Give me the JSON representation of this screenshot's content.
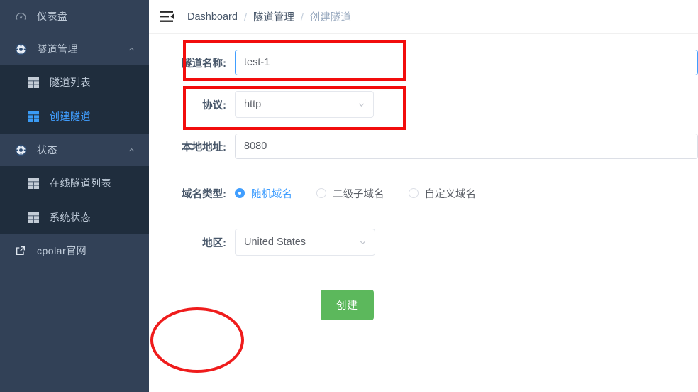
{
  "sidebar": {
    "items": [
      {
        "label": "仪表盘",
        "icon": "dashboard-icon",
        "type": "link"
      },
      {
        "label": "隧道管理",
        "icon": "compass-icon",
        "type": "group",
        "expanded": true,
        "arrow": "chevron-up-icon"
      },
      {
        "label": "状态",
        "icon": "compass-icon",
        "type": "group",
        "expanded": true,
        "arrow": "chevron-up-icon"
      },
      {
        "label": "cpolar官网",
        "icon": "external-link-icon",
        "type": "link"
      }
    ],
    "tunnel_submenu": [
      {
        "label": "隧道列表",
        "icon": "grid-icon",
        "active": false
      },
      {
        "label": "创建隧道",
        "icon": "grid-icon",
        "active": true
      }
    ],
    "status_submenu": [
      {
        "label": "在线隧道列表",
        "icon": "grid-icon",
        "active": false
      },
      {
        "label": "系统状态",
        "icon": "grid-icon",
        "active": false
      }
    ]
  },
  "topbar": {
    "menu_icon": "hamburger-collapse-icon",
    "breadcrumb": [
      {
        "label": "Dashboard",
        "current": false
      },
      {
        "label": "隧道管理",
        "current": false
      },
      {
        "label": "创建隧道",
        "current": true
      }
    ],
    "separator": "/"
  },
  "form": {
    "name": {
      "label": "隧道名称:",
      "value": "test-1",
      "focused": true
    },
    "protocol": {
      "label": "协议:",
      "value": "http",
      "caret": "chevron-down-icon"
    },
    "local_address": {
      "label": "本地地址:",
      "value": "8080"
    },
    "domain_type": {
      "label": "域名类型:",
      "options": [
        {
          "label": "随机域名",
          "checked": true
        },
        {
          "label": "二级子域名",
          "checked": false
        },
        {
          "label": "自定义域名",
          "checked": false
        }
      ]
    },
    "region": {
      "label": "地区:",
      "value": "United States",
      "caret": "chevron-down-icon"
    },
    "submit": {
      "label": "创建"
    }
  },
  "colors": {
    "sidebar_bg": "#324157",
    "submenu_bg": "#1f2d3d",
    "accent_blue": "#409eff",
    "button_green": "#5cb85c",
    "annotation_red": "#f20d0d",
    "label_text": "#48576a"
  },
  "annotations": [
    {
      "shape": "rect",
      "target": "tunnel-name-row"
    },
    {
      "shape": "rect",
      "target": "protocol-row"
    },
    {
      "shape": "ellipse",
      "target": "create-button"
    }
  ]
}
